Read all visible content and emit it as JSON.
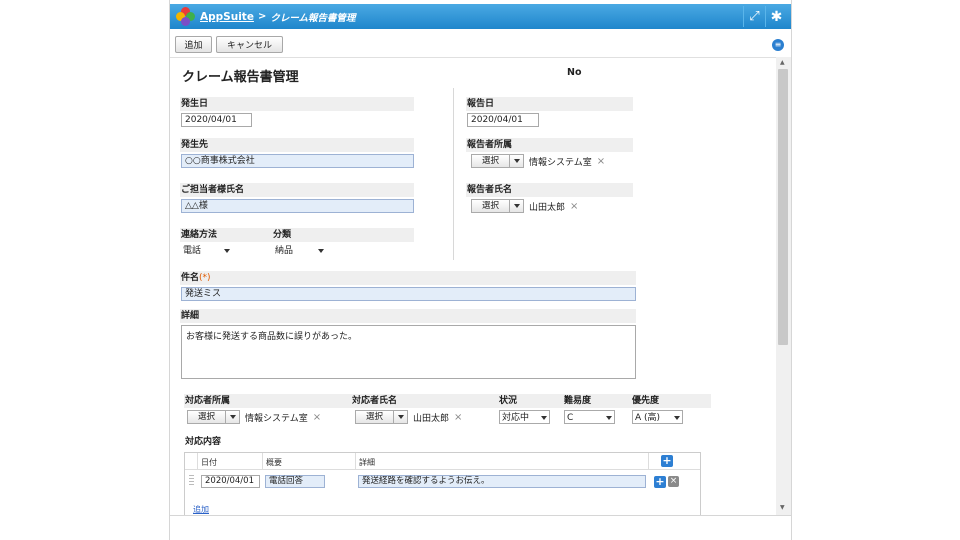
{
  "header": {
    "app_name": "AppSuite",
    "separator": ">",
    "breadcrumb": "クレーム報告書管理",
    "fullscreen_glyph": "⤢",
    "settings_glyph": "✱"
  },
  "toolbar": {
    "add_label": "追加",
    "cancel_label": "キャンセル"
  },
  "form": {
    "title": "クレーム報告書管理",
    "no_label": "No",
    "occurrence_date": {
      "label": "発生日",
      "value": "2020/04/01"
    },
    "report_date": {
      "label": "報告日",
      "value": "2020/04/01"
    },
    "occurrence_place": {
      "label": "発生先",
      "value": "○○商事株式会社"
    },
    "reporter_dept": {
      "label": "報告者所属",
      "select_label": "選択",
      "value": "情報システム室",
      "remove": "×"
    },
    "contact_person": {
      "label": "ご担当者様氏名",
      "value": "△△様"
    },
    "reporter_name": {
      "label": "報告者氏名",
      "select_label": "選択",
      "value": "山田太郎",
      "remove": "×"
    },
    "contact_method": {
      "label": "連絡方法",
      "value": "電話"
    },
    "category": {
      "label": "分類",
      "value": "納品"
    },
    "subject": {
      "label": "件名",
      "required_mark": "(*)",
      "value": "発送ミス"
    },
    "detail": {
      "label": "詳細",
      "value": "お客様に発送する商品数に誤りがあった。"
    },
    "handler_dept": {
      "label": "対応者所属",
      "select_label": "選択",
      "value": "情報システム室",
      "remove": "×"
    },
    "handler_name": {
      "label": "対応者氏名",
      "select_label": "選択",
      "value": "山田太郎",
      "remove": "×"
    },
    "status": {
      "label": "状況",
      "value": "対応中"
    },
    "difficulty": {
      "label": "難易度",
      "value": "C"
    },
    "priority": {
      "label": "優先度",
      "value": "A (高)"
    },
    "response": {
      "label": "対応内容",
      "columns": [
        "日付",
        "概要",
        "詳細"
      ],
      "rows": [
        {
          "date": "2020/04/01",
          "summary": "電話回答",
          "detail": "発送経路を確認するようお伝え。"
        }
      ],
      "add_link": "追加",
      "plus_glyph": "+",
      "remove_glyph": "×"
    }
  },
  "colors": {
    "header_blue": "#1f86cc",
    "accent_blue": "#2d7fd3",
    "required": "#e05a00"
  }
}
